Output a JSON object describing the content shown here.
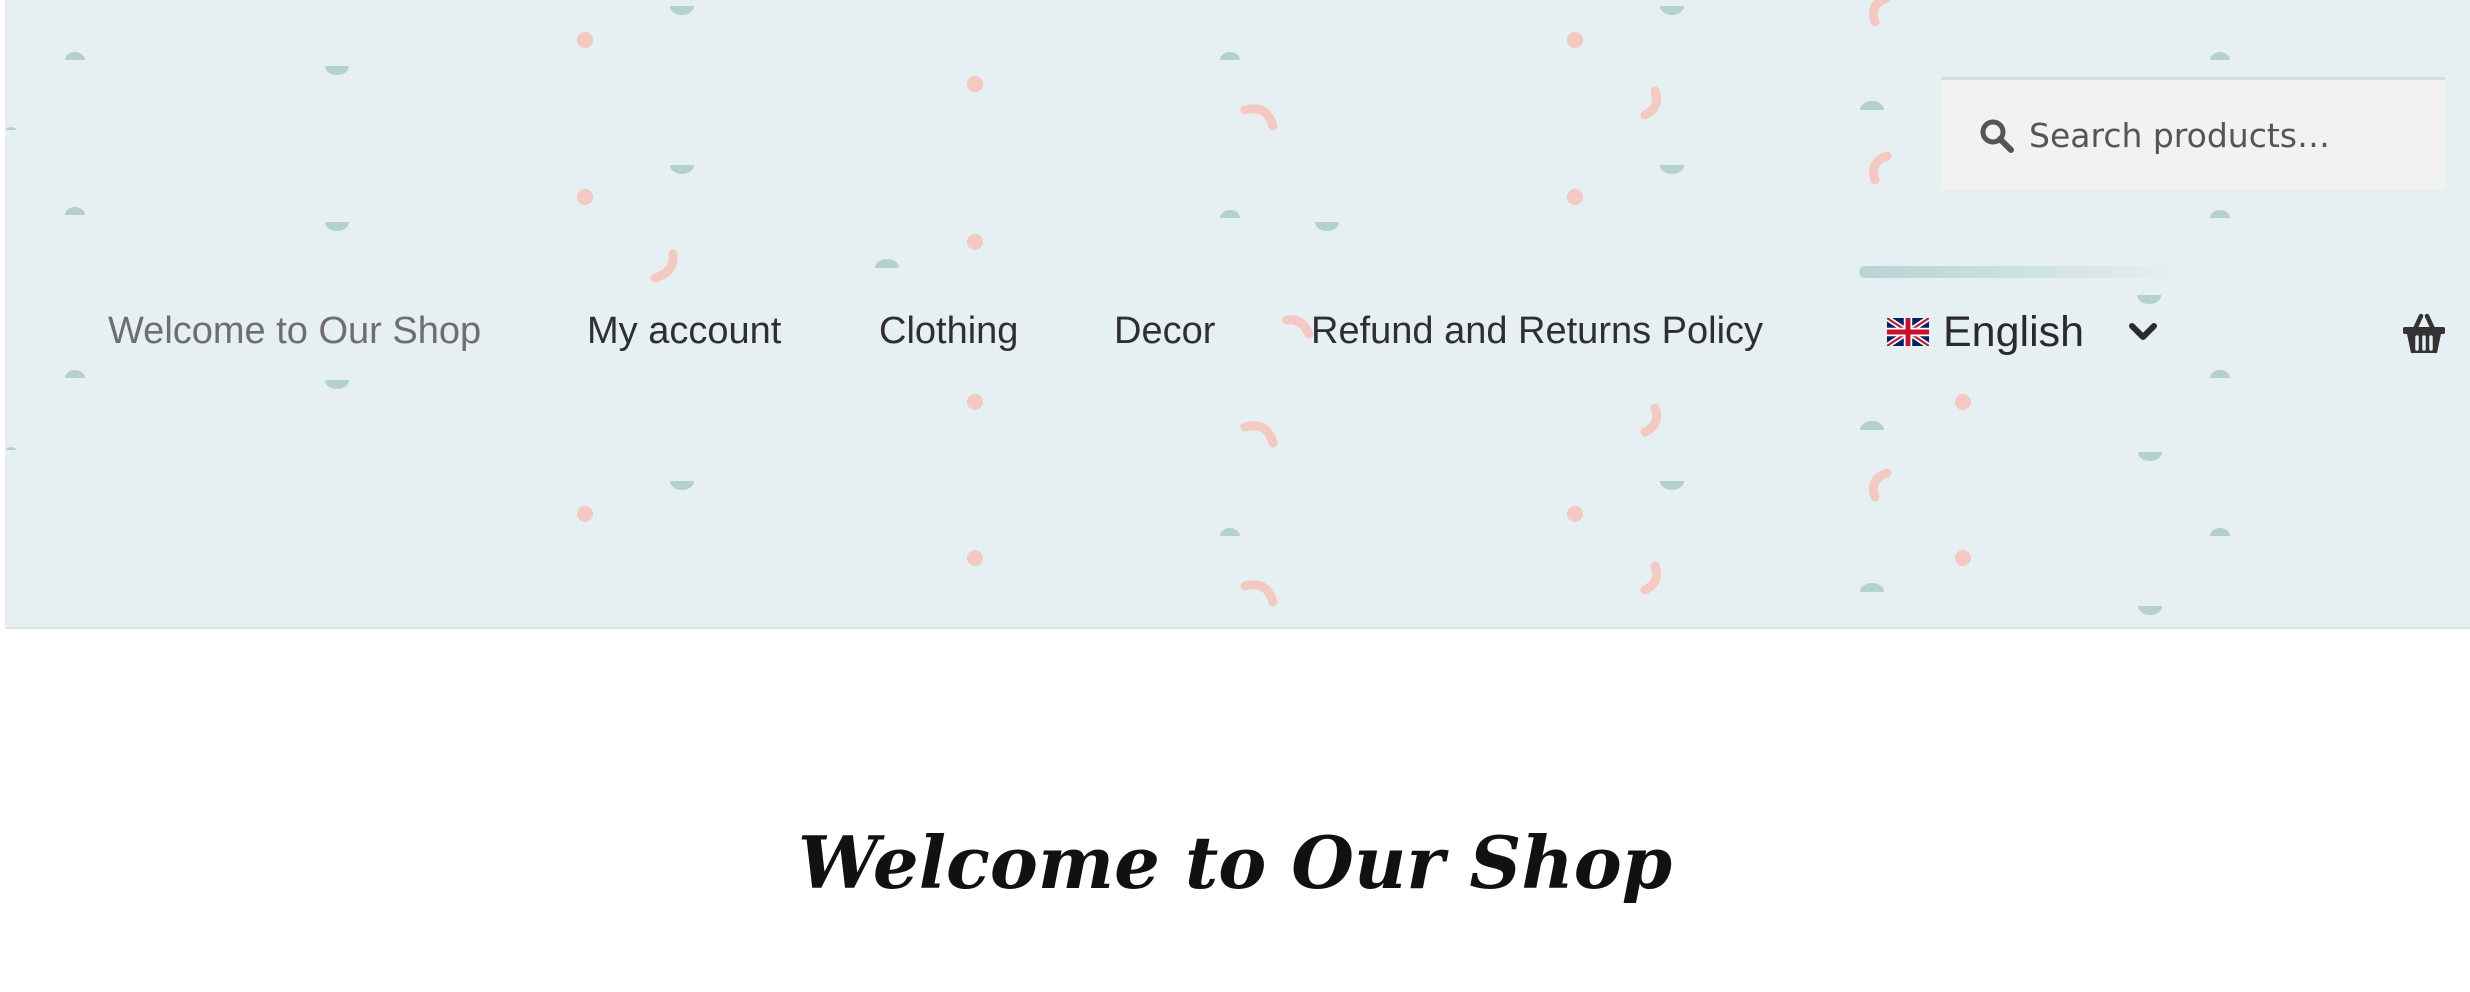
{
  "header": {
    "search": {
      "placeholder": "Search products…",
      "icon": "search-icon"
    },
    "nav": {
      "items": [
        {
          "label": "Welcome to Our Shop",
          "current": true
        },
        {
          "label": "My account"
        },
        {
          "label": "Clothing"
        },
        {
          "label": "Decor"
        },
        {
          "label": "Refund and Returns Policy"
        }
      ]
    },
    "language": {
      "label": "English",
      "flag_icon": "uk-flag-icon",
      "chevron_icon": "chevron-down-icon"
    },
    "cart": {
      "icon": "basket-icon"
    }
  },
  "main": {
    "title": "Welcome to Our Shop"
  },
  "colors": {
    "header_bg": "#e6eff1",
    "pattern_teal": "#a9cbc7",
    "pattern_pink": "#f5c4bb",
    "text": "#2f2f2f"
  }
}
